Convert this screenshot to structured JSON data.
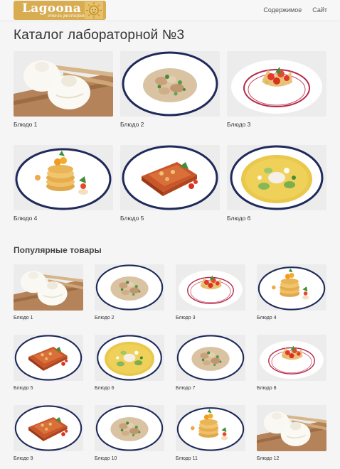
{
  "header": {
    "logo_text": "Lagoona",
    "logo_sub": "отель-ресторан",
    "nav": [
      {
        "label": "Содержимое"
      },
      {
        "label": "Сайт"
      }
    ]
  },
  "catalog": {
    "title": "Каталог лабораторной №3",
    "items": [
      {
        "label": "Блюдо 1",
        "dish": "dumplings"
      },
      {
        "label": "Блюдо 2",
        "dish": "pasta"
      },
      {
        "label": "Блюдо 3",
        "dish": "tart"
      },
      {
        "label": "Блюдо 4",
        "dish": "stack"
      },
      {
        "label": "Блюдо 5",
        "dish": "lasagna"
      },
      {
        "label": "Блюдо 6",
        "dish": "soup"
      }
    ]
  },
  "popular": {
    "title": "Популярные товары",
    "items": [
      {
        "label": "Блюдо 1",
        "dish": "dumplings"
      },
      {
        "label": "Блюдо 2",
        "dish": "pasta"
      },
      {
        "label": "Блюдо 3",
        "dish": "tart"
      },
      {
        "label": "Блюдо 4",
        "dish": "stack"
      },
      {
        "label": "Блюдо 5",
        "dish": "lasagna"
      },
      {
        "label": "Блюдо 6",
        "dish": "soup"
      },
      {
        "label": "Блюдо 7",
        "dish": "pasta"
      },
      {
        "label": "Блюдо 8",
        "dish": "tart"
      },
      {
        "label": "Блюдо 9",
        "dish": "lasagna"
      },
      {
        "label": "Блюдо 10",
        "dish": "pasta"
      },
      {
        "label": "Блюдо 11",
        "dish": "stack"
      },
      {
        "label": "Блюдо 12",
        "dish": "dumplings"
      }
    ]
  },
  "colors": {
    "logo_bg": "#d8ad52",
    "plate_rim": "#1f2a5a",
    "page_bg": "#f5f5f5"
  }
}
